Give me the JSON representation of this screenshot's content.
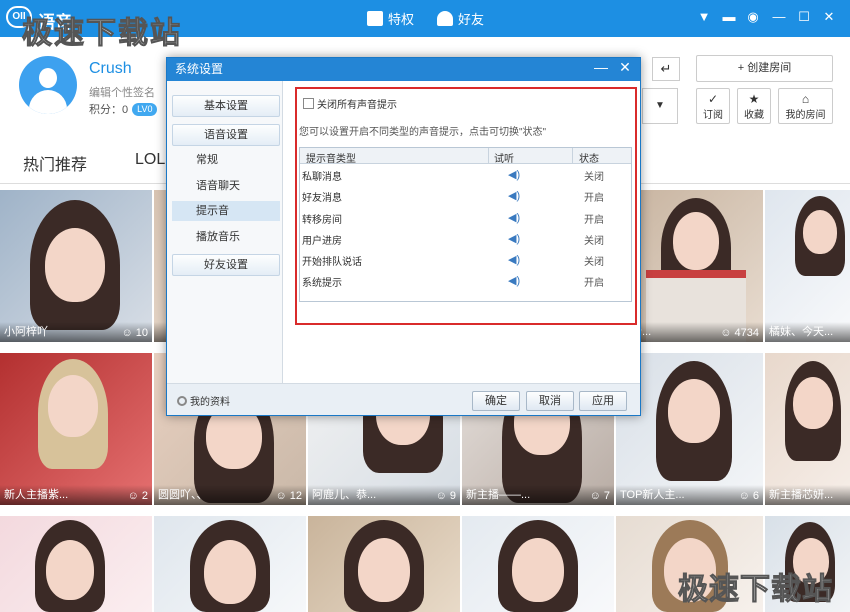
{
  "topbar": {
    "app_name": "语音",
    "watermark": "极速下载站",
    "nav_privilege": "特权",
    "nav_friends": "好友",
    "icons": [
      "shirt-icon",
      "message-icon",
      "settings-icon",
      "minimize-icon",
      "maximize-icon",
      "close-icon"
    ]
  },
  "profile": {
    "username": "Crush",
    "signature": "编辑个性签名",
    "points_label": "积分：0",
    "level": "LV0"
  },
  "room": {
    "create_label": "+ 创建房间",
    "subscribe": "订阅",
    "favorites": "收藏",
    "my_room": "我的房间"
  },
  "tabs": {
    "hot": "热门推荐",
    "lol": "LOL"
  },
  "tiles": [
    {
      "name": "小阿梓吖",
      "count": "10"
    },
    {
      "name": "",
      "count": ""
    },
    {
      "name": "",
      "count": ""
    },
    {
      "name": "",
      "count": ""
    },
    {
      "name": "人兮...",
      "count": "4734"
    },
    {
      "name": "橘妹、今天...",
      "count": ""
    },
    {
      "name": "新人主播紫...",
      "count": "2"
    },
    {
      "name": "圆圆吖、、",
      "count": "12"
    },
    {
      "name": "阿鹿儿、恭...",
      "count": "9"
    },
    {
      "name": "新主播——...",
      "count": "7"
    },
    {
      "name": "TOP新人主...",
      "count": "6"
    },
    {
      "name": "新主播芯妍...",
      "count": ""
    }
  ],
  "watermark_bottom": "极速下载站",
  "dialog": {
    "title": "系统设置",
    "categories": {
      "basic": "基本设置",
      "voice": "语音设置",
      "general": "常规",
      "voice_chat": "语音聊天",
      "notify_sound": "提示音",
      "play_music": "播放音乐",
      "friends": "好友设置"
    },
    "mute_all": "关闭所有声音提示",
    "hint": "您可以设置开启不同类型的声音提示，点击可切换\"状态\"",
    "columns": {
      "type": "提示音类型",
      "listen": "试听",
      "state": "状态"
    },
    "rows": [
      {
        "type": "私聊消息",
        "state": "关闭"
      },
      {
        "type": "好友消息",
        "state": "开启"
      },
      {
        "type": "转移房间",
        "state": "开启"
      },
      {
        "type": "用户进房",
        "state": "关闭"
      },
      {
        "type": "开始排队说话",
        "state": "关闭"
      },
      {
        "type": "系统提示",
        "state": "开启"
      }
    ],
    "my_profile": "我的资料",
    "ok": "确定",
    "cancel": "取消",
    "apply": "应用"
  },
  "colors": {
    "topbar": "#1d8fe3",
    "dialog_title": "#2485d5",
    "highlight_border": "#d92b2b"
  }
}
